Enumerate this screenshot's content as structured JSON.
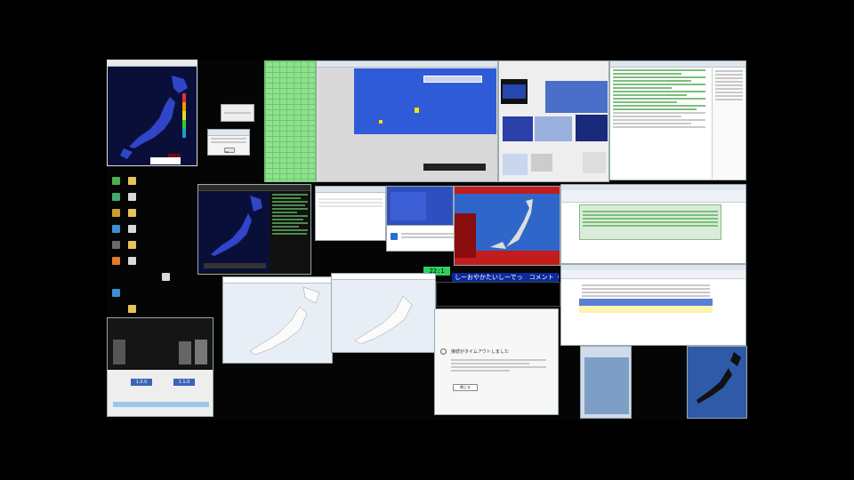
{
  "layout": {
    "letterbox": "pillarbox"
  },
  "colors": {
    "desktop_bg": "#050505",
    "quake_map_sea": "#0a0f3a",
    "quake_map_land": "#3145c9",
    "blue_screen": "#2f5bd8",
    "green_grid": "#8fe08f",
    "ticker_bg": "#0a2a9a",
    "ticker_green": "#2fd060"
  },
  "windows": {
    "quake_monitor": {
      "icon": "japan-map-icon",
      "logo_label": "NIED"
    },
    "small_dialog": {
      "button_label": "OK"
    },
    "blue_screen": {
      "overlay_label": "",
      "status_label": ""
    },
    "stream_ticker": {
      "counter": "22:1",
      "text": "しーおやかたいしーでっ　コメント（ツ"
    },
    "error_dialog": {
      "icon": "info-icon",
      "title": "接続がタイムアウトしました",
      "button_label": "閉じる"
    },
    "taskbar_panel": {
      "left_value": "1.0.0",
      "right_value": "1.1.0"
    }
  },
  "desktop_icons": [
    {
      "name": "recycle-bin-icon",
      "color": "#4caf50"
    },
    {
      "name": "folder-icon",
      "color": "#e6c55a"
    },
    {
      "name": "app-icon",
      "color": "#44a86e"
    },
    {
      "name": "document-icon",
      "color": "#d9d9d9"
    },
    {
      "name": "app-icon-2",
      "color": "#cc9b2e"
    },
    {
      "name": "folder-icon-2",
      "color": "#e6c55a"
    },
    {
      "name": "app-icon-3",
      "color": "#3f8fd1"
    },
    {
      "name": "document-icon-2",
      "color": "#d9d9d9"
    },
    {
      "name": "app-icon-4",
      "color": "#6b6b6b"
    },
    {
      "name": "folder-icon-3",
      "color": "#e6c55a"
    },
    {
      "name": "app-icon-5",
      "color": "#e07b2c"
    },
    {
      "name": "document-icon-3",
      "color": "#d9d9d9"
    },
    {
      "name": "app-icon-6",
      "color": "#3f8fd1"
    },
    {
      "name": "folder-icon-4",
      "color": "#e6c55a"
    }
  ]
}
